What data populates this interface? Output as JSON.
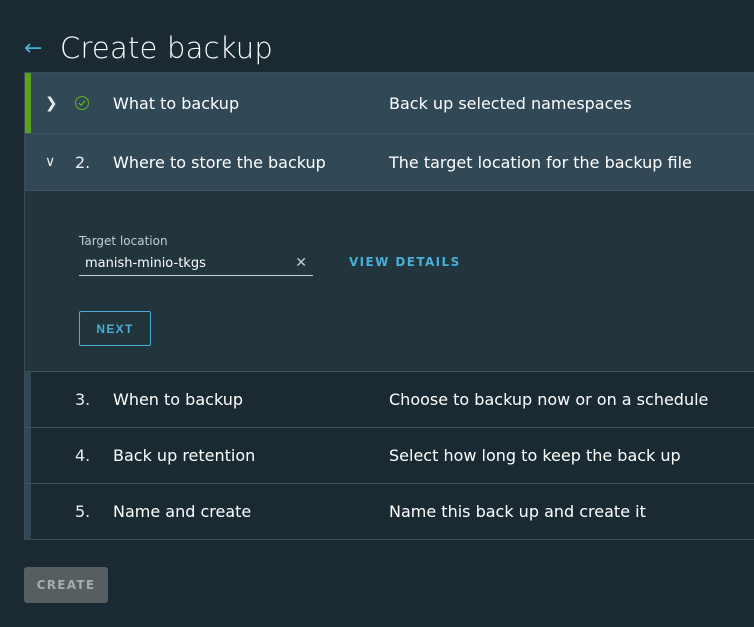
{
  "header": {
    "back_icon": "arrow-left-icon",
    "title": "Create backup"
  },
  "steps": [
    {
      "number": "",
      "name": "What to backup",
      "description": "Back up selected namespaces",
      "status": "complete",
      "icon": "check-circle-icon"
    },
    {
      "number": "2.",
      "name": "Where to store the backup",
      "description": "The target location for the backup file",
      "status": "active"
    },
    {
      "number": "3.",
      "name": "When to backup",
      "description": "Choose to backup now or on a schedule",
      "status": "pending"
    },
    {
      "number": "4.",
      "name": "Back up retention",
      "description": "Select how long to keep the back up",
      "status": "pending"
    },
    {
      "number": "5.",
      "name": "Name and create",
      "description": "Name this back up and create it",
      "status": "pending"
    }
  ],
  "step2": {
    "target_label": "Target location",
    "target_value": "manish-minio-tkgs",
    "view_details": "VIEW DETAILS",
    "next_label": "NEXT"
  },
  "footer": {
    "create_label": "CREATE"
  },
  "colors": {
    "accent": "#49afd9",
    "success": "#60b515",
    "background": "#1b2a32"
  }
}
